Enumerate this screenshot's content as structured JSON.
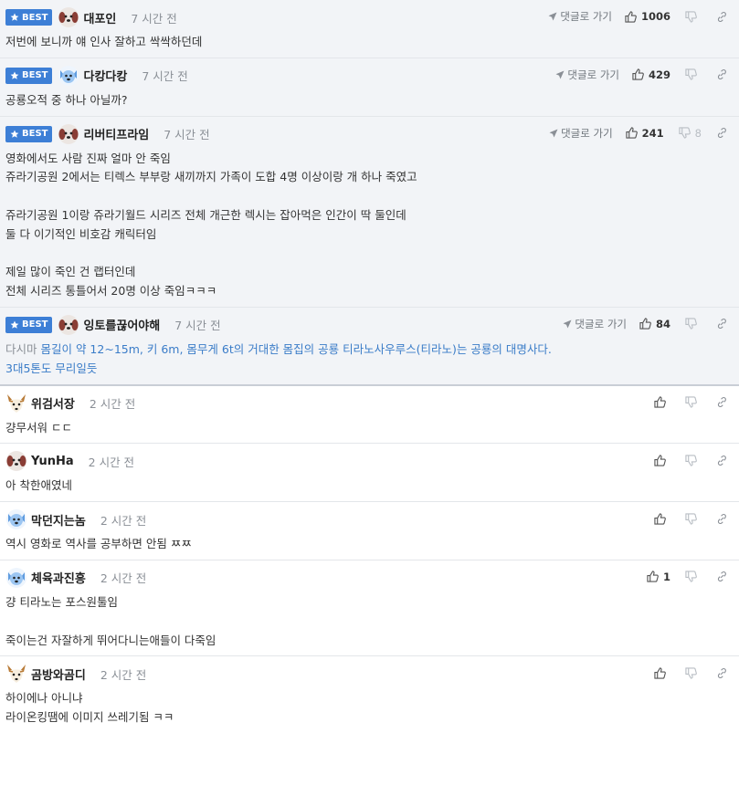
{
  "labels": {
    "best": "BEST",
    "reply": "댓글로 가기"
  },
  "comments": [
    {
      "nick": "대포인",
      "time": "7 시간 전",
      "likes": "1006",
      "dislikes": "",
      "avatar": "dog-icon",
      "lines": [
        "저번에 보니까 얘 인사 잘하고 싹싹하던데"
      ]
    },
    {
      "nick": "다캉다캉",
      "time": "7 시간 전",
      "likes": "429",
      "dislikes": "",
      "avatar": "blue-dog-icon",
      "lines": [
        "공룡오적 중 하나 아닐까?"
      ]
    },
    {
      "nick": "리버티프라임",
      "time": "7 시간 전",
      "likes": "241",
      "dislikes": "8",
      "avatar": "dog-icon",
      "lines": [
        "영화에서도 사람 진짜 얼마 안 죽임",
        "쥬라기공원 2에서는 티렉스 부부랑 새끼까지 가족이 도합 4명 이상이랑 개 하나 죽였고",
        "",
        "쥬라기공원 1이랑 쥬라기월드 시리즈 전체 개근한 렉시는 잡아먹은 인간이 딱 둘인데",
        "둘 다 이기적인 비호감 캐릭터임",
        "",
        "제일 많이 죽인 건 랩터인데",
        "전체 시리즈 통틀어서 20명 이상 죽임ㅋㅋㅋ"
      ]
    },
    {
      "nick": "잉토를끊어야해",
      "time": "7 시간 전",
      "likes": "84",
      "dislikes": "",
      "avatar": "dog-icon",
      "quote_lead": "다시마",
      "quote_rest": " 몸길이 약 12~15m, 키 6m, 몸무게 6t의 거대한 몸집의 공룡 티라노사우루스(티라노)는 공룡의 대명사다.",
      "lines": [
        "3대5톤도 무리일듯"
      ]
    },
    {
      "nick": "위검서장",
      "time": "2 시간 전",
      "likes": "",
      "dislikes": "",
      "avatar": "fox-icon",
      "lines": [
        "걍무서워 ㄷㄷ"
      ]
    },
    {
      "nick": "YunHa",
      "time": "2 시간 전",
      "likes": "",
      "dislikes": "",
      "avatar": "dog-icon",
      "lines": [
        "아 착한애였네"
      ]
    },
    {
      "nick": "막던지는놈",
      "time": "2 시간 전",
      "likes": "",
      "dislikes": "",
      "avatar": "blue-dog-icon",
      "lines": [
        "역시 영화로 역사를 공부하면 안됨 ㅉㅉ"
      ]
    },
    {
      "nick": "체육과진흥",
      "time": "2 시간 전",
      "likes": "1",
      "dislikes": "",
      "avatar": "blue-dog-icon",
      "lines": [
        "걍 티라노는 포스원툴임",
        "",
        "죽이는건 자잘하게 뛰어다니는애들이 다죽임"
      ]
    },
    {
      "nick": "곰방와곰디",
      "time": "2 시간 전",
      "likes": "",
      "dislikes": "",
      "avatar": "fox-icon",
      "lines": [
        "하이에나 아니냐",
        "라이온킹땜에 이미지 쓰레기됨 ㅋㅋ"
      ]
    }
  ]
}
